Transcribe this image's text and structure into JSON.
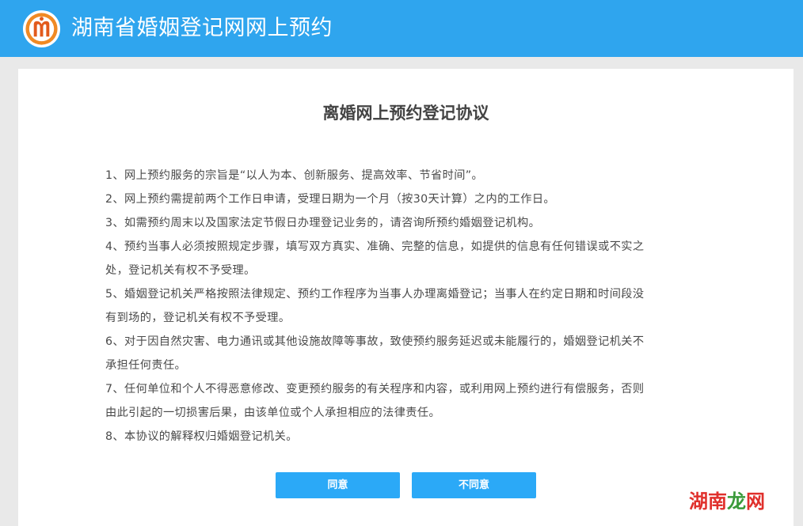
{
  "header": {
    "site_title": "湖南省婚姻登记网网上预约",
    "bg_color": "#2fa5ee",
    "logo_icon": "hands-heart-logo-icon"
  },
  "agreement": {
    "title": "离婚网上预约登记协议",
    "items": [
      {
        "lines": [
          "1、网上预约服务的宗旨是“以人为本、创新服务、提高效率、节省时间”。"
        ]
      },
      {
        "lines": [
          "2、网上预约需提前两个工作日申请，受理日期为一个月（按30天计算）之内的工作日。"
        ]
      },
      {
        "lines": [
          "3、如需预约周末以及国家法定节假日办理登记业务的，请咨询所预约婚姻登记机构。"
        ]
      },
      {
        "lines": [
          "4、预约当事人必须按照规定步骤，填写双方真实、准确、完整的信息，如提供的信息有任何错误或不实之",
          "处，登记机关有权不予受理。"
        ]
      },
      {
        "lines": [
          "5、婚姻登记机关严格按照法律规定、预约工作程序为当事人办理离婚登记；当事人在约定日期和时间段没",
          "有到场的，登记机关有权不予受理。"
        ]
      },
      {
        "lines": [
          "6、对于因自然灾害、电力通讯或其他设施故障等事故，致使预约服务延迟或未能履行的，婚姻登记机关不",
          "承担任何责任。"
        ]
      },
      {
        "lines": [
          "7、任何单位和个人不得恶意修改、变更预约服务的有关程序和内容，或利用网上预约进行有偿服务，否则",
          "由此引起的一切损害后果，由该单位或个人承担相应的法律责任。"
        ]
      },
      {
        "lines": [
          "8、本协议的解释权归婚姻登记机关。"
        ]
      }
    ]
  },
  "buttons": {
    "agree_label": "同意",
    "disagree_label": "不同意",
    "color": "#2ba9f7"
  },
  "watermark": {
    "text_part1": "湖南",
    "text_part2": "龙",
    "text_part3": "网"
  }
}
